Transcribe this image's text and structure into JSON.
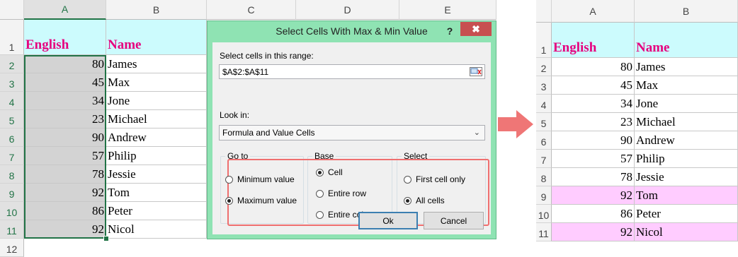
{
  "left_sheet": {
    "columns": [
      "A",
      "B",
      "C",
      "D",
      "E"
    ],
    "rows": [
      "1",
      "2",
      "3",
      "4",
      "5",
      "6",
      "7",
      "8",
      "9",
      "10",
      "11",
      "12"
    ],
    "header_english": "English",
    "header_name": "Name",
    "data": [
      {
        "english": "80",
        "name": "James"
      },
      {
        "english": "45",
        "name": "Max"
      },
      {
        "english": "34",
        "name": "Jone"
      },
      {
        "english": "23",
        "name": "Michael"
      },
      {
        "english": "90",
        "name": "Andrew"
      },
      {
        "english": "57",
        "name": "Philip"
      },
      {
        "english": "78",
        "name": "Jessie"
      },
      {
        "english": "92",
        "name": "Tom"
      },
      {
        "english": "86",
        "name": "Peter"
      },
      {
        "english": "92",
        "name": "Nicol"
      }
    ]
  },
  "dialog": {
    "title": "Select Cells With Max & Min Value",
    "help": "?",
    "close": "✖",
    "range_label": "Select cells in this range:",
    "range_value": "$A$2:$A$11",
    "lookin_label": "Look in:",
    "lookin_value": "Formula and Value Cells",
    "goto_title": "Go to",
    "goto_min": "Minimum value",
    "goto_max": "Maximum value",
    "base_title": "Base",
    "base_cell": "Cell",
    "base_row": "Entire row",
    "base_col": "Entire column",
    "select_title": "Select",
    "select_first": "First cell only",
    "select_all": "All cells",
    "ok": "Ok",
    "cancel": "Cancel",
    "accent_red": "#ef6f6f"
  },
  "right_sheet": {
    "columns": [
      "A",
      "B"
    ],
    "rows": [
      "1",
      "2",
      "3",
      "4",
      "5",
      "6",
      "7",
      "8",
      "9",
      "10",
      "11"
    ],
    "header_english": "English",
    "header_name": "Name",
    "data": [
      {
        "english": "80",
        "name": "James"
      },
      {
        "english": "45",
        "name": "Max"
      },
      {
        "english": "34",
        "name": "Jone"
      },
      {
        "english": "23",
        "name": "Michael"
      },
      {
        "english": "90",
        "name": "Andrew"
      },
      {
        "english": "57",
        "name": "Philip"
      },
      {
        "english": "78",
        "name": "Jessie"
      },
      {
        "english": "92",
        "name": "Tom",
        "highlight": true
      },
      {
        "english": "86",
        "name": "Peter"
      },
      {
        "english": "92",
        "name": "Nicol",
        "highlight": true
      }
    ],
    "highlight_color": "#ffccff"
  }
}
